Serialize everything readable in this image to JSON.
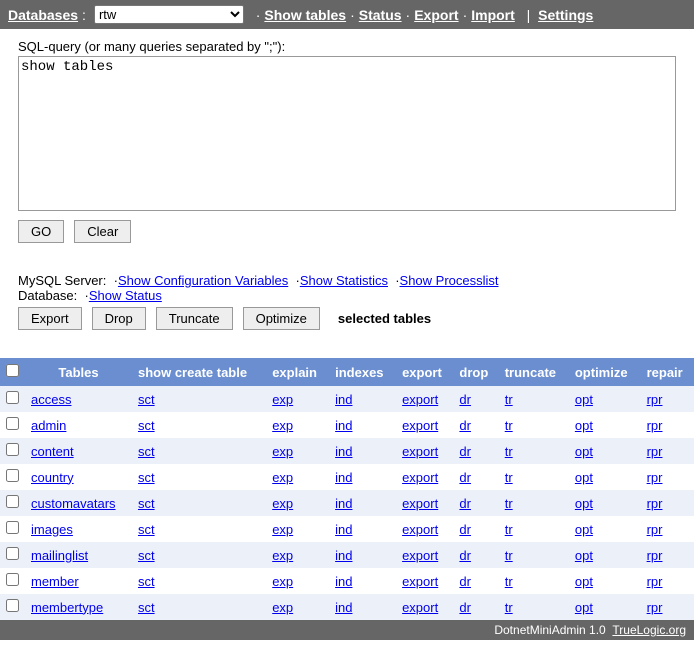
{
  "topbar": {
    "databases_label": "Databases",
    "selected_db": "rtw",
    "show_tables": "Show tables",
    "status": "Status",
    "export": "Export",
    "import": "Import",
    "settings": "Settings"
  },
  "sql": {
    "label": "SQL-query (or many queries separated by \";\"):",
    "value": "show tables",
    "go_btn": "GO",
    "clear_btn": "Clear"
  },
  "server": {
    "mysql_label": "MySQL Server:",
    "show_config": "Show Configuration Variables",
    "show_stats": "Show Statistics",
    "show_proc": "Show Processlist",
    "db_label": "Database:",
    "show_status": "Show Status"
  },
  "actions": {
    "export": "Export",
    "drop": "Drop",
    "truncate": "Truncate",
    "optimize": "Optimize",
    "selected": "selected tables"
  },
  "table": {
    "headers": {
      "tables": "Tables",
      "sct": "show create table",
      "explain": "explain",
      "indexes": "indexes",
      "export": "export",
      "drop": "drop",
      "truncate": "truncate",
      "optimize": "optimize",
      "repair": "repair"
    },
    "link_labels": {
      "sct": "sct",
      "exp": "exp",
      "ind": "ind",
      "export": "export",
      "dr": "dr",
      "tr": "tr",
      "opt": "opt",
      "rpr": "rpr"
    },
    "rows": [
      {
        "name": "access"
      },
      {
        "name": "admin"
      },
      {
        "name": "content"
      },
      {
        "name": "country"
      },
      {
        "name": "customavatars"
      },
      {
        "name": "images"
      },
      {
        "name": "mailinglist"
      },
      {
        "name": "member"
      },
      {
        "name": "membertype"
      }
    ]
  },
  "footer": {
    "text": "DotnetMiniAdmin 1.0",
    "link": "TrueLogic.org"
  }
}
